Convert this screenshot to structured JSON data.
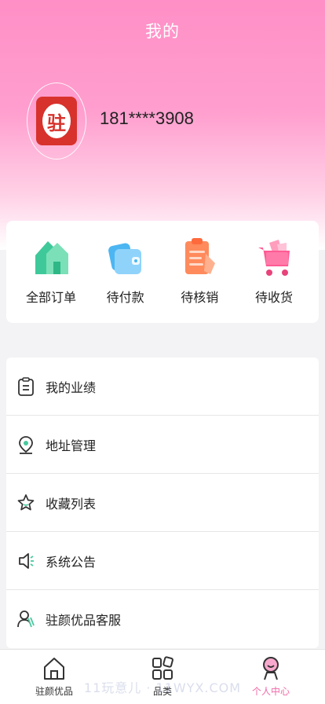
{
  "header": {
    "title": "我的"
  },
  "profile": {
    "avatar_text": "驻",
    "phone": "181****3908"
  },
  "orders": [
    {
      "label": "全部订单",
      "icon": "house-icon"
    },
    {
      "label": "待付款",
      "icon": "wallet-icon"
    },
    {
      "label": "待核销",
      "icon": "clipboard-icon"
    },
    {
      "label": "待收货",
      "icon": "cart-icon"
    }
  ],
  "menu": [
    {
      "label": "我的业绩",
      "icon": "clipboard-list-icon"
    },
    {
      "label": "地址管理",
      "icon": "location-pin-icon"
    },
    {
      "label": "收藏列表",
      "icon": "star-icon"
    },
    {
      "label": "系统公告",
      "icon": "speaker-icon"
    },
    {
      "label": "驻颜优品客服",
      "icon": "customer-service-icon"
    }
  ],
  "tabbar": [
    {
      "label": "驻颜优品",
      "icon": "home-icon"
    },
    {
      "label": "品类",
      "icon": "category-grid-icon"
    },
    {
      "label": "个人中心",
      "icon": "profile-icon",
      "active": true
    }
  ],
  "watermark": "11玩意儿 · 11WYX.COM",
  "colors": {
    "accent": "#f06aa9",
    "hero_top": "#ff8fc6",
    "logo_red": "#d8322c"
  }
}
